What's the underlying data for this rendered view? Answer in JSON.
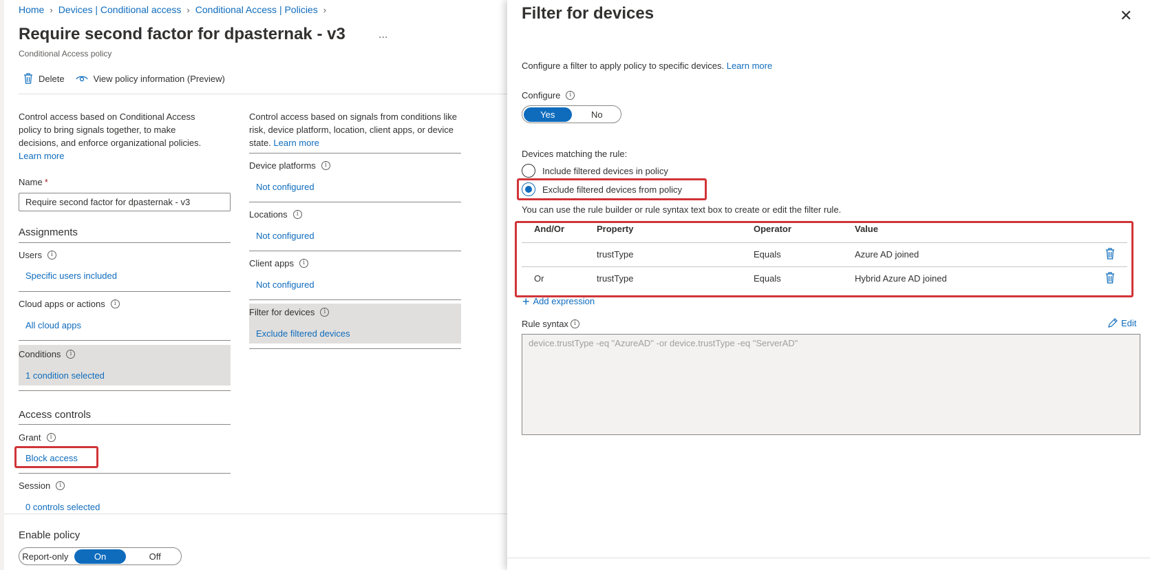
{
  "breadcrumb": [
    "Home",
    "Devices | Conditional access",
    "Conditional Access | Policies"
  ],
  "page": {
    "title": "Require second factor for dpasternak - v3",
    "more": "...",
    "subtitle": "Conditional Access policy"
  },
  "toolbar": {
    "delete_label": "Delete",
    "view_info_label": "View policy information (Preview)"
  },
  "left": {
    "description": "Control access based on Conditional Access policy to bring signals together, to make decisions, and enforce organizational policies.",
    "learn_more": "Learn more",
    "name_label": "Name",
    "name_required": "*",
    "name_value": "Require second factor for dpasternak - v3",
    "assignments_heading": "Assignments",
    "users_label": "Users",
    "users_value": "Specific users included",
    "cloud_label": "Cloud apps or actions",
    "cloud_value": "All cloud apps",
    "conditions_label": "Conditions",
    "conditions_value": "1 condition selected",
    "access_heading": "Access controls",
    "grant_label": "Grant",
    "grant_value": "Block access",
    "session_label": "Session",
    "session_value": "0 controls selected",
    "enable_label": "Enable policy",
    "enable_options": [
      "Report-only",
      "On",
      "Off"
    ],
    "enable_selected": "On"
  },
  "middle": {
    "description": "Control access based on signals from conditions like risk, device platform, location, client apps, or device state.",
    "learn_more": "Learn more",
    "platforms_label": "Device platforms",
    "platforms_value": "Not configured",
    "locations_label": "Locations",
    "locations_value": "Not configured",
    "client_label": "Client apps",
    "client_value": "Not configured",
    "filter_label": "Filter for devices",
    "filter_value": "Exclude filtered devices"
  },
  "panel": {
    "title": "Filter for devices",
    "close": "✕",
    "description": "Configure a filter to apply policy to specific devices.",
    "learn_more": "Learn more",
    "configure_label": "Configure",
    "configure_options": [
      "Yes",
      "No"
    ],
    "configure_selected": "Yes",
    "matching_label": "Devices matching the rule:",
    "include_option": "Include filtered devices in policy",
    "exclude_option": "Exclude filtered devices from policy",
    "selected_option": "exclude",
    "rule_hint": "You can use the rule builder or rule syntax text box to create or edit the filter rule.",
    "table": {
      "headers": [
        "And/Or",
        "Property",
        "Operator",
        "Value"
      ],
      "rows": [
        {
          "andor": "",
          "property": "trustType",
          "operator": "Equals",
          "value": "Azure AD joined"
        },
        {
          "andor": "Or",
          "property": "trustType",
          "operator": "Equals",
          "value": "Hybrid Azure AD joined"
        }
      ]
    },
    "add_expression": "Add expression",
    "rule_syntax_label": "Rule syntax",
    "edit_label": "Edit",
    "rule_syntax_value": "device.trustType -eq \"AzureAD\" -or device.trustType -eq \"ServerAD\""
  },
  "colors": {
    "accent": "#0f6cbd",
    "highlight": "#d13438",
    "selected_bg": "#e1dfdd"
  }
}
